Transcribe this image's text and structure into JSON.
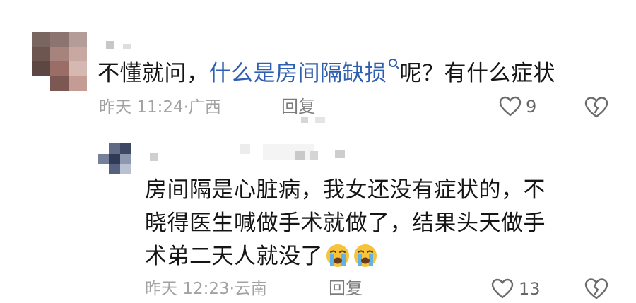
{
  "comments": [
    {
      "text_before": "不懂就问，",
      "link_text": "什么是房间隔缺损",
      "text_after": "呢？有什么症状",
      "time": "昨天 11:24",
      "location": "广西",
      "reply_label": "回复",
      "like_count": "9",
      "colors": {
        "link": "#2f5fb0"
      }
    },
    {
      "line1": "房间隔是心脏病，我女还没有症状的，不",
      "line2": "晓得医生喊做手术就做了，结果头天做手",
      "line3": "术弟二天人就没了",
      "emoji": [
        "crying-face",
        "crying-face"
      ],
      "time": "昨天 12:23",
      "location": "云南",
      "reply_label": "回复",
      "like_count": "13"
    }
  ],
  "icons": [
    "heart-icon",
    "dislike-heart-icon",
    "search-icon",
    "avatar"
  ]
}
